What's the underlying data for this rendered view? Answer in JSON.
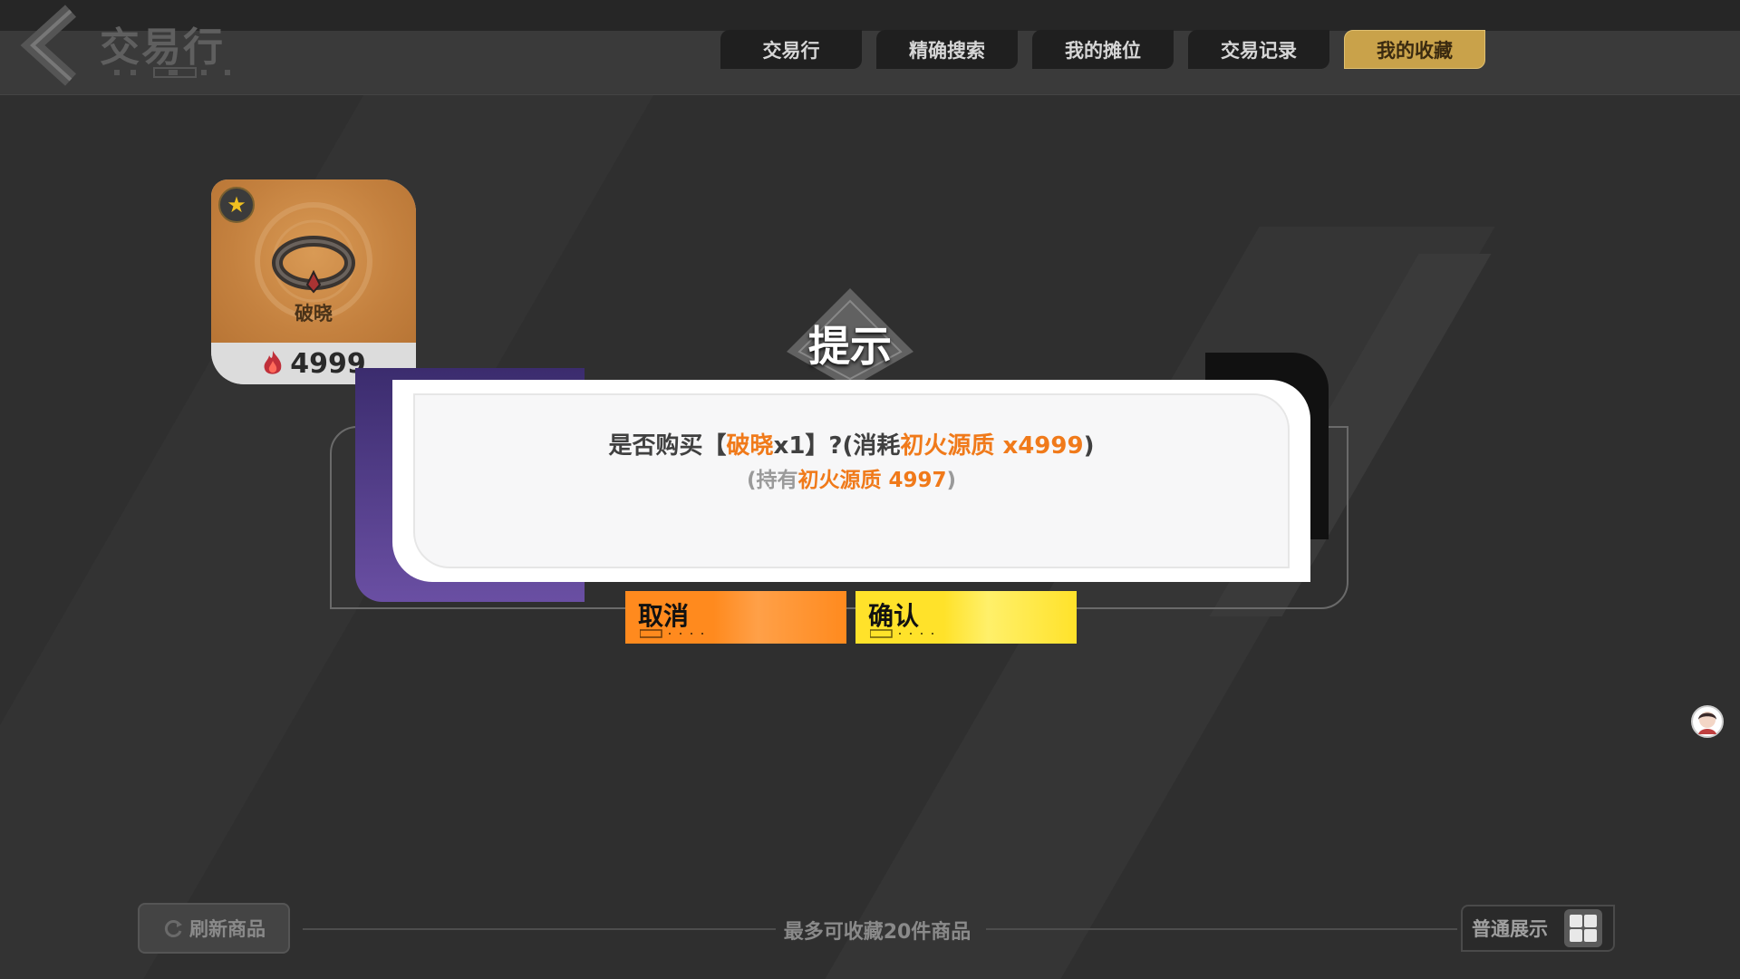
{
  "header": {
    "title": "交易行",
    "tabs": [
      {
        "label": "交易行"
      },
      {
        "label": "精确搜索"
      },
      {
        "label": "我的摊位"
      },
      {
        "label": "交易记录"
      },
      {
        "label": "我的收藏",
        "active": true
      }
    ]
  },
  "item": {
    "name": "破晓",
    "price": "4999"
  },
  "dialog": {
    "title": "提示",
    "line1_prefix": "是否购买【",
    "line1_item": "破晓",
    "line1_qty": "x1",
    "line1_mid": "】?(消耗",
    "line1_cost": "初火源质 x4999",
    "line1_suffix": ")",
    "line2_prefix": "(持有",
    "line2_hold": "初火源质 4997",
    "line2_suffix": ")",
    "cancel_label": "取消",
    "confirm_label": "确认"
  },
  "footer": {
    "refresh_label": "刷新商品",
    "note": "最多可收藏20件商品",
    "view_label": "普通展示"
  },
  "colors": {
    "accent_orange": "#ff8a1e",
    "accent_yellow": "#ffe22a",
    "highlight_text": "#f07a1a",
    "active_tab": "#c9a24a"
  },
  "icons": [
    "back-arrow-icon",
    "star-icon",
    "flame-icon",
    "grid-view-icon",
    "refresh-icon",
    "avatar-icon"
  ]
}
